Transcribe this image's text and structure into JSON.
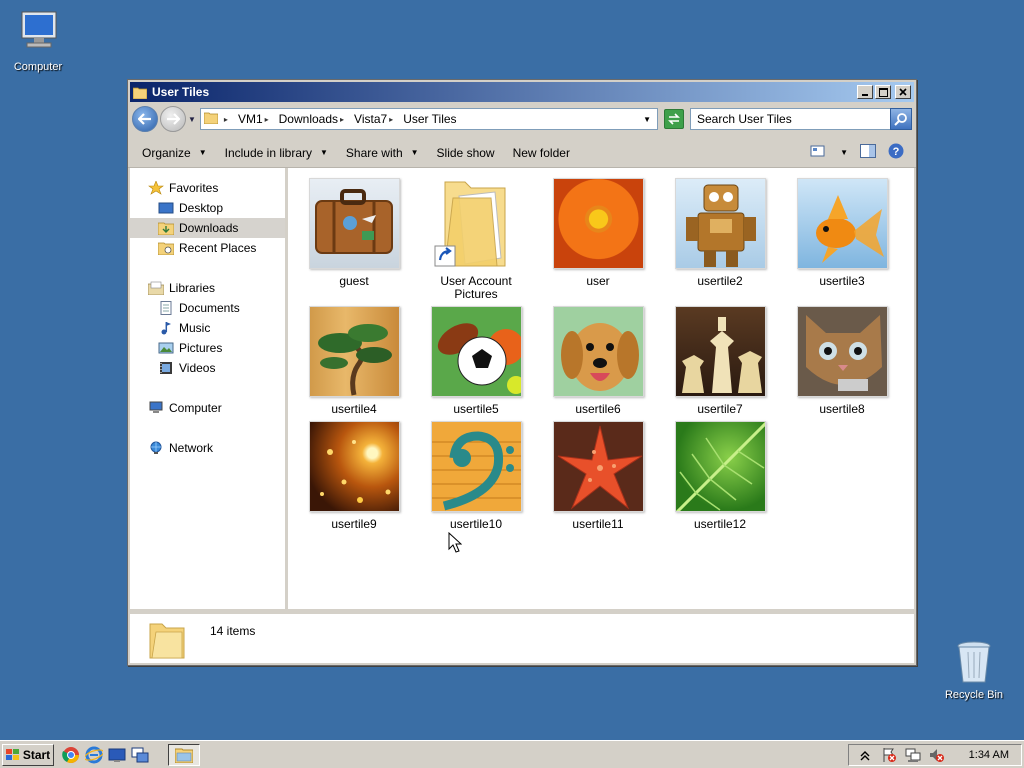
{
  "desktop": {
    "icons": [
      {
        "label": "Computer"
      },
      {
        "label": "Recycle Bin"
      }
    ]
  },
  "window": {
    "title": "User Tiles",
    "address": {
      "crumbs": [
        "VM1",
        "Downloads",
        "Vista7",
        "User Tiles"
      ]
    },
    "search": {
      "placeholder": "Search User Tiles"
    },
    "toolbar": {
      "organize": "Organize",
      "include_in_library": "Include in library",
      "share_with": "Share with",
      "slide_show": "Slide show",
      "new_folder": "New folder"
    },
    "nav": {
      "favorites": {
        "label": "Favorites",
        "items": [
          "Desktop",
          "Downloads",
          "Recent Places"
        ],
        "selected": "Downloads"
      },
      "libraries": {
        "label": "Libraries",
        "items": [
          "Documents",
          "Music",
          "Pictures",
          "Videos"
        ]
      },
      "computer": {
        "label": "Computer"
      },
      "network": {
        "label": "Network"
      }
    },
    "files": [
      {
        "name": "guest",
        "kind": "image",
        "thumb": "suitcase"
      },
      {
        "name": "User Account Pictures",
        "kind": "folder-shortcut"
      },
      {
        "name": "user",
        "kind": "image",
        "thumb": "orange-flower"
      },
      {
        "name": "usertile2",
        "kind": "image",
        "thumb": "toy-robot"
      },
      {
        "name": "usertile3",
        "kind": "image",
        "thumb": "goldfish"
      },
      {
        "name": "usertile4",
        "kind": "image",
        "thumb": "bonsai"
      },
      {
        "name": "usertile5",
        "kind": "image",
        "thumb": "sports-balls"
      },
      {
        "name": "usertile6",
        "kind": "image",
        "thumb": "puppy"
      },
      {
        "name": "usertile7",
        "kind": "image",
        "thumb": "chess"
      },
      {
        "name": "usertile8",
        "kind": "image",
        "thumb": "kitten"
      },
      {
        "name": "usertile9",
        "kind": "image",
        "thumb": "sparkles"
      },
      {
        "name": "usertile10",
        "kind": "image",
        "thumb": "bass-clef"
      },
      {
        "name": "usertile11",
        "kind": "image",
        "thumb": "starfish"
      },
      {
        "name": "usertile12",
        "kind": "image",
        "thumb": "green-leaf"
      }
    ],
    "status": {
      "item_count": "14 items"
    }
  },
  "taskbar": {
    "start_label": "Start",
    "clock": "1:34 AM"
  }
}
